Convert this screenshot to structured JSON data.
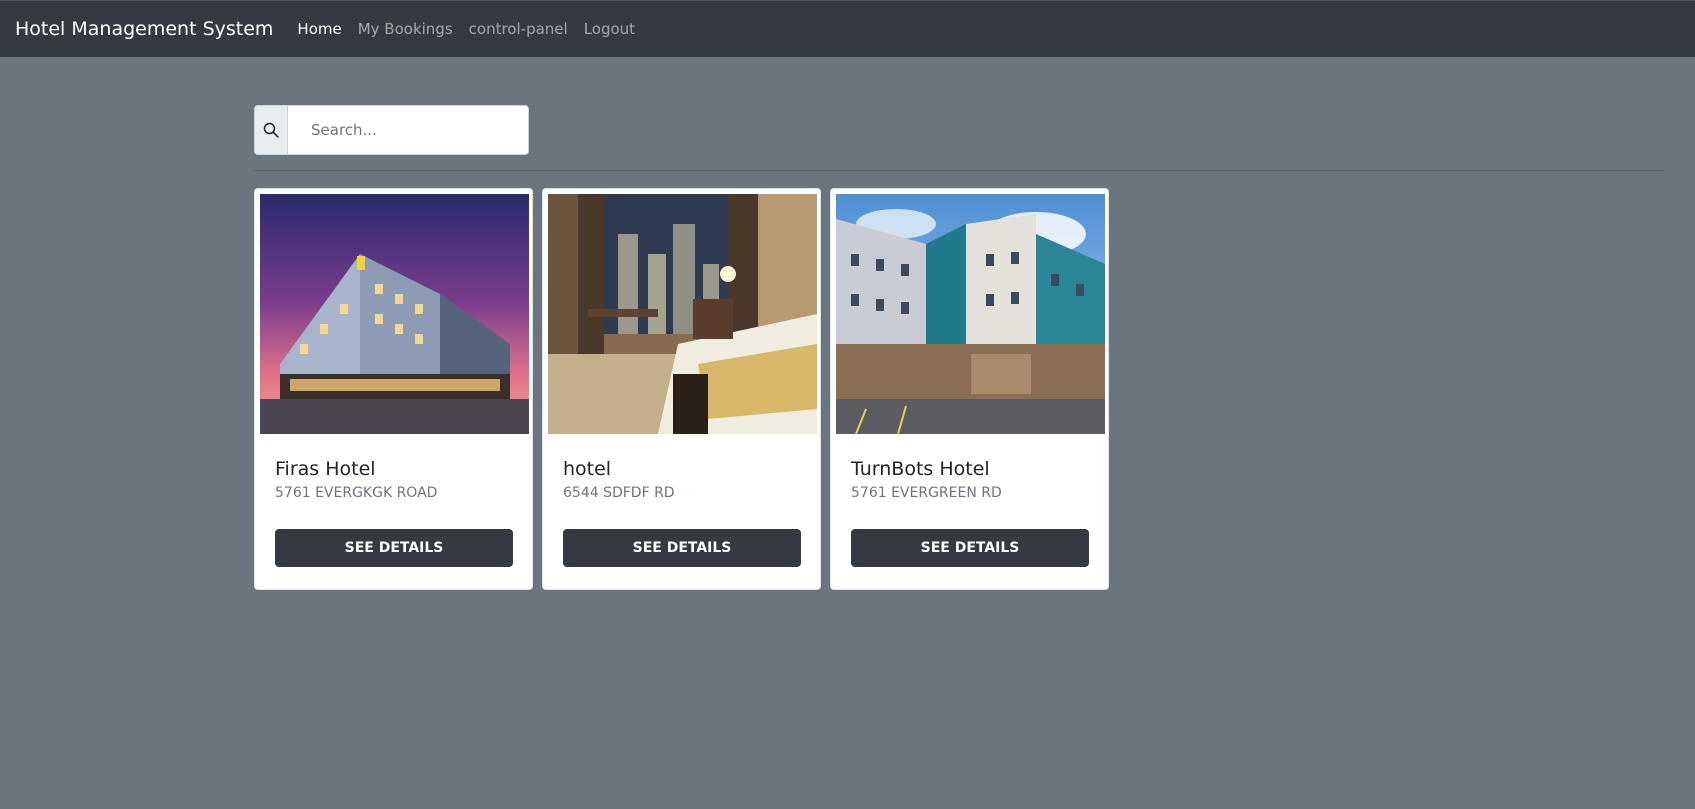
{
  "navbar": {
    "brand": "Hotel Management System",
    "links": [
      {
        "label": "Home",
        "active": true
      },
      {
        "label": "My Bookings",
        "active": false
      },
      {
        "label": "control-panel",
        "active": false
      },
      {
        "label": "Logout",
        "active": false
      }
    ]
  },
  "search": {
    "placeholder": "Search...",
    "value": "",
    "icon": "search-icon"
  },
  "hotels": [
    {
      "name": "Firas Hotel",
      "address": "5761 EVERGKGK ROAD",
      "button_label": "SEE DETAILS",
      "image": "hotel-building-dusk-photo"
    },
    {
      "name": "hotel",
      "address": "6544 SDFDF RD",
      "button_label": "SEE DETAILS",
      "image": "hotel-room-interior-photo"
    },
    {
      "name": "TurnBots Hotel",
      "address": "5761 EVERGREEN RD",
      "button_label": "SEE DETAILS",
      "image": "hotel-building-daytime-photo"
    }
  ],
  "colors": {
    "navbar_bg": "#343a40",
    "page_bg": "#6c757d",
    "button_bg": "#343a40"
  }
}
